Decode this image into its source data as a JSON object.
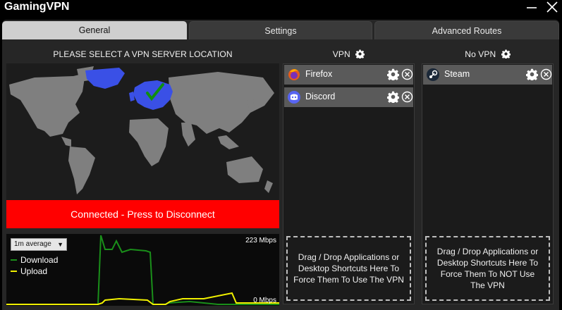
{
  "app": {
    "title": "GamingVPN",
    "window_controls": {
      "minimize_icon": "minimize-icon",
      "close_icon": "close-icon"
    }
  },
  "tabs": [
    {
      "label": "General",
      "active": true
    },
    {
      "label": "Settings",
      "active": false
    },
    {
      "label": "Advanced Routes",
      "active": false
    }
  ],
  "map_section": {
    "title": "PLEASE SELECT A VPN SERVER LOCATION",
    "highlight_color": "#3a50e6",
    "land_color": "#7f7f7f",
    "selected_marker_icon": "checkmark-icon"
  },
  "connect_button": {
    "label": "Connected - Press to Disconnect",
    "color": "#ff0000"
  },
  "bandwidth": {
    "average_select": "1m average",
    "legend": [
      {
        "label": "Download",
        "color": "#1a8f1a"
      },
      {
        "label": "Upload",
        "color": "#f0f000"
      }
    ],
    "max_label": "223 Mbps",
    "min_label": "0 Mbps"
  },
  "vpn_panel": {
    "title": "VPN",
    "settings_icon": "gear-icon",
    "apps": [
      {
        "name": "Firefox",
        "icon": "firefox-icon"
      },
      {
        "name": "Discord",
        "icon": "discord-icon"
      }
    ],
    "dropzone_text": "Drag / Drop Applications or Desktop Shortcuts Here To Force Them To Use The VPN"
  },
  "novpn_panel": {
    "title": "No VPN",
    "settings_icon": "gear-icon",
    "apps": [
      {
        "name": "Steam",
        "icon": "steam-icon"
      }
    ],
    "dropzone_text": "Drag / Drop Applications or Desktop Shortcuts Here To Force Them To NOT Use The VPN"
  }
}
